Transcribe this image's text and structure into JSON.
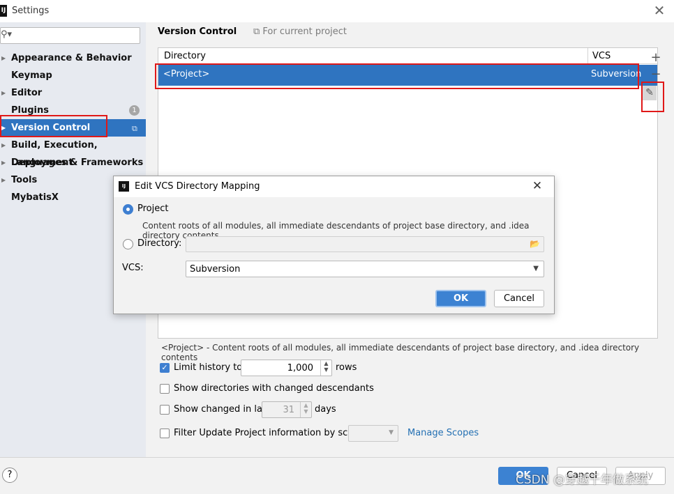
{
  "window": {
    "title": "Settings",
    "app_icon": "IJ",
    "close_glyph": "✕"
  },
  "sidebar": {
    "search_placeholder": "",
    "items": [
      {
        "label": "Appearance & Behavior",
        "expandable": true
      },
      {
        "label": "Keymap",
        "expandable": false
      },
      {
        "label": "Editor",
        "expandable": true
      },
      {
        "label": "Plugins",
        "expandable": false,
        "badge": "1"
      },
      {
        "label": "Version Control",
        "expandable": true,
        "selected": true
      },
      {
        "label": "Build, Execution, Deployment",
        "expandable": true
      },
      {
        "label": "Languages & Frameworks",
        "expandable": true
      },
      {
        "label": "Tools",
        "expandable": true
      },
      {
        "label": "MybatisX",
        "expandable": false
      }
    ]
  },
  "page": {
    "title": "Version Control",
    "scope_note": "For current project",
    "table": {
      "columns": [
        "Directory",
        "VCS"
      ],
      "rows": [
        {
          "directory": "<Project>",
          "vcs": "Subversion",
          "selected": true
        }
      ]
    },
    "toolbar": {
      "add": "+",
      "remove": "−",
      "edit": "✎"
    },
    "description": "<Project> - Content roots of all modules, all immediate descendants of project base directory, and .idea directory contents",
    "options": {
      "limit_history": {
        "label": "Limit history to:",
        "checked": true,
        "value": "1,000",
        "suffix": "rows"
      },
      "show_dirs": {
        "label": "Show directories with changed descendants",
        "checked": false
      },
      "show_changed": {
        "label": "Show changed in last",
        "checked": false,
        "value": "31",
        "suffix": "days"
      },
      "filter_update": {
        "label": "Filter Update Project information by scope",
        "checked": false,
        "link": "Manage Scopes"
      }
    }
  },
  "footer": {
    "help": "?",
    "ok": "OK",
    "cancel": "Cancel",
    "apply": "Apply"
  },
  "dialog": {
    "title": "Edit VCS Directory Mapping",
    "project_label": "Project",
    "project_hint": "Content roots of all modules, all immediate descendants of project base directory, and .idea directory contents",
    "directory_label": "Directory:",
    "vcs_label": "VCS:",
    "vcs_value": "Subversion",
    "ok": "OK",
    "cancel": "Cancel"
  },
  "watermark": "CSDN @穿越千年做系统",
  "colors": {
    "accent": "#2f74c0",
    "highlight": "#e01818",
    "link": "#2470b3"
  }
}
